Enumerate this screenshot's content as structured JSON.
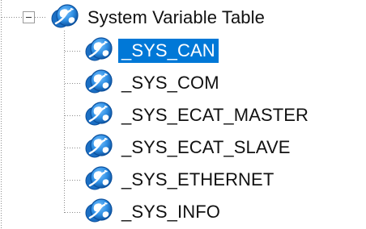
{
  "tree": {
    "root": {
      "label": "System Variable Table",
      "icon": "globe-variable-icon",
      "expanded": true
    },
    "children": [
      {
        "label": "_SYS_CAN",
        "icon": "globe-variable-icon",
        "selected": true
      },
      {
        "label": "_SYS_COM",
        "icon": "globe-variable-icon",
        "selected": false
      },
      {
        "label": "_SYS_ECAT_MASTER",
        "icon": "globe-variable-icon",
        "selected": false
      },
      {
        "label": "_SYS_ECAT_SLAVE",
        "icon": "globe-variable-icon",
        "selected": false
      },
      {
        "label": "_SYS_ETHERNET",
        "icon": "globe-variable-icon",
        "selected": false
      },
      {
        "label": "_SYS_INFO",
        "icon": "globe-variable-icon",
        "selected": false
      }
    ]
  },
  "colors": {
    "selection": "#0078d7",
    "globe_blue": "#2f8fe4",
    "globe_dark": "#0b4f9c",
    "tree_line": "#8c8c8c"
  }
}
